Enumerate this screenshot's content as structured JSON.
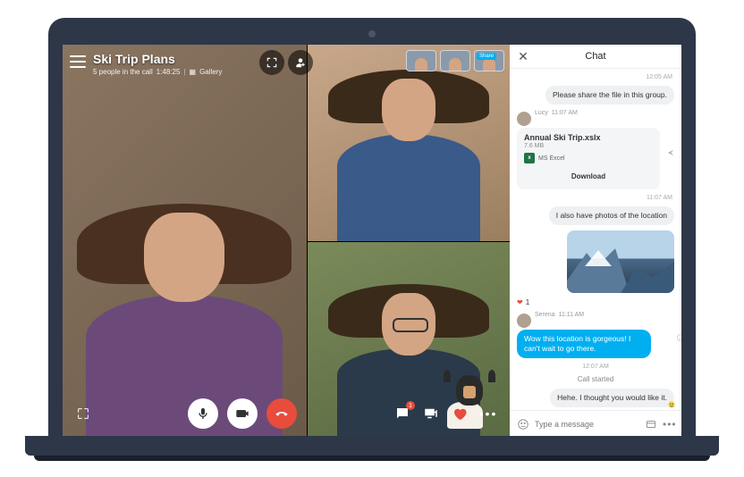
{
  "call": {
    "title": "Ski Trip Plans",
    "subtitle_people": "5 people in the call",
    "subtitle_duration": "1:48:25",
    "view_mode": "Gallery"
  },
  "pips": {
    "badge_label": "Share"
  },
  "controls": {
    "chat_badge": "1"
  },
  "chat": {
    "header": "Chat",
    "messages": {
      "m0_time": "12:05 AM",
      "m0_text": "Please share the file in this group.",
      "m1_sender": "Lucy",
      "m1_time": "11:07 AM",
      "m1_file_name": "Annual Ski Trip.xslx",
      "m1_file_size": "7.6 MB",
      "m1_file_type": "MS Excel",
      "m1_download": "Download",
      "m2_time": "11:07 AM",
      "m2_text": "I also have photos of the location",
      "m3_react_count": "1",
      "m4_sender": "Serena",
      "m4_time": "11:11 AM",
      "m4_text": "Wow this location is gorgeous! I can't wait to go there.",
      "m5_time": "12:07 AM",
      "m5_sys": "Call started",
      "m6_text": "Hehe. I thought you would like it."
    },
    "input_placeholder": "Type a message"
  },
  "colors": {
    "accent": "#00aff0",
    "danger": "#e74c3c",
    "excel": "#217346"
  }
}
